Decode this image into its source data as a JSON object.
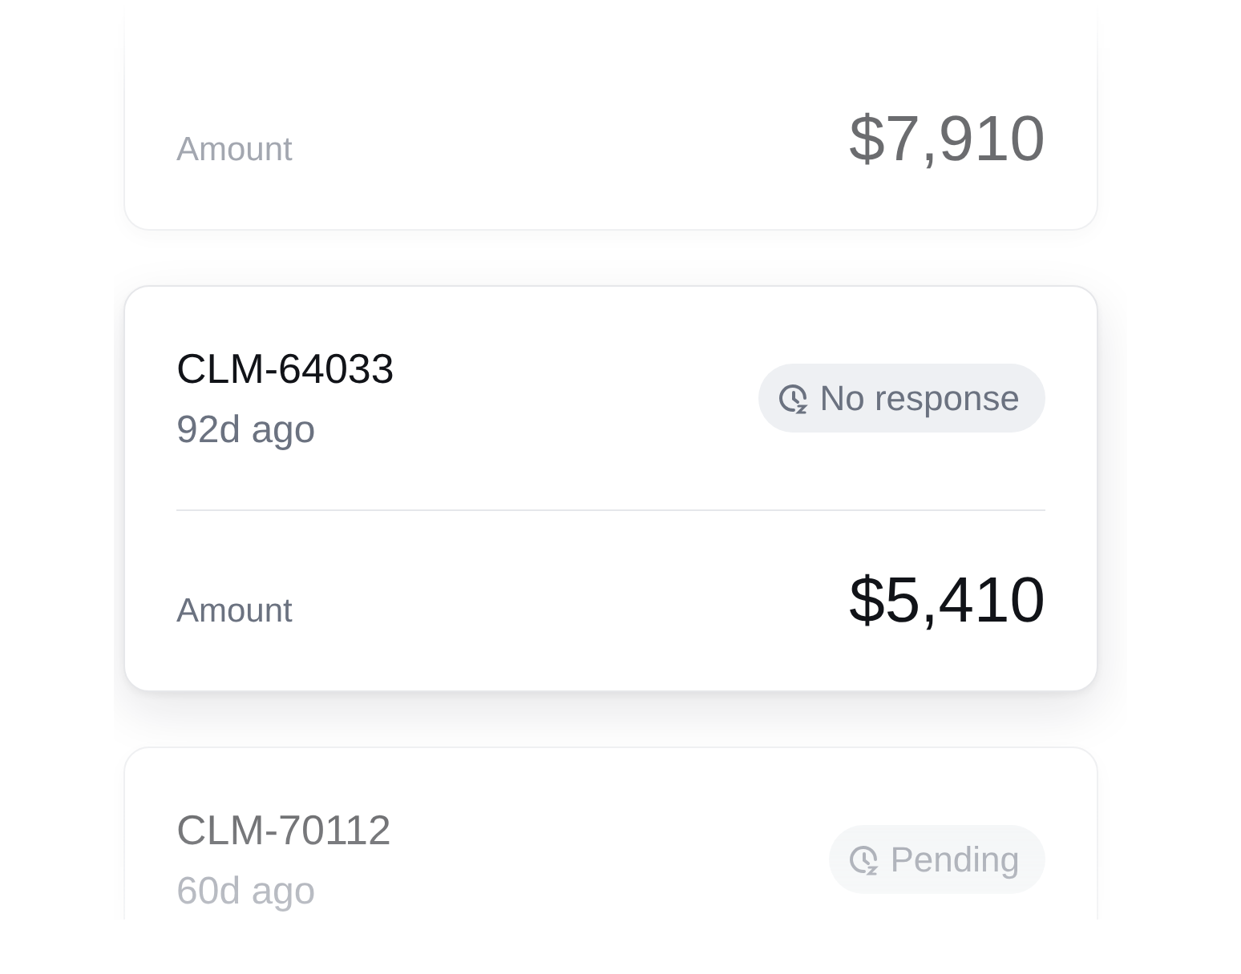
{
  "cards": [
    {
      "focused": false,
      "amount_label": "Amount",
      "amount": "$7,910"
    },
    {
      "focused": true,
      "id": "CLM-64033",
      "age": "92d ago",
      "status": "No response",
      "amount_label": "Amount",
      "amount": "$5,410"
    },
    {
      "focused": false,
      "id": "CLM-70112",
      "age": "60d ago",
      "status": "Pending"
    }
  ]
}
